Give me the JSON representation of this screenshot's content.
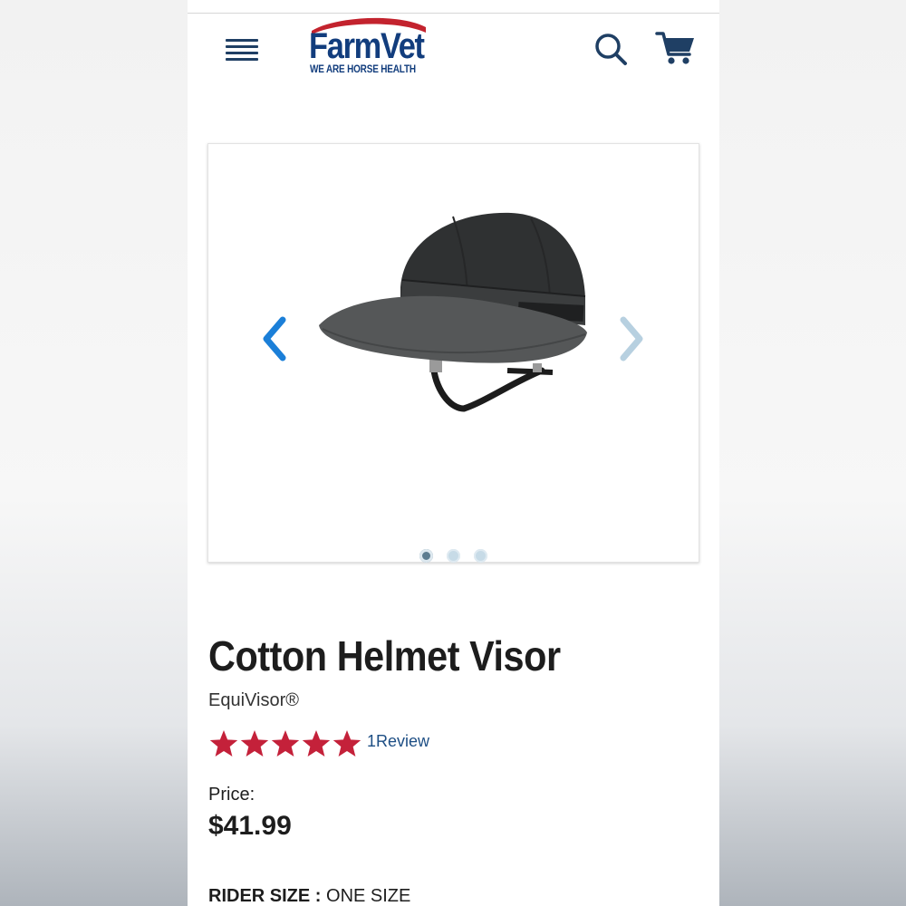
{
  "header": {
    "logo_name": "FarmVet",
    "logo_tagline": "WE ARE HORSE HEALTH",
    "icons": [
      "menu-icon",
      "search-icon",
      "cart-icon"
    ]
  },
  "gallery": {
    "image_count": 3,
    "active_index": 0,
    "icons": [
      "chevron-left-icon",
      "chevron-right-icon"
    ]
  },
  "product": {
    "title": "Cotton Helmet Visor",
    "brand": "EquiVisor®",
    "rating": 5,
    "rating_max": 5,
    "review_text": "1Review",
    "price_label": "Price:",
    "price": "$41.99",
    "size_label": "RIDER SIZE :",
    "size_value": "ONE SIZE"
  },
  "colors": {
    "brand_navy": "#123d7d",
    "logo_red": "#c3232e",
    "star_red": "#c4213a",
    "arrow_active": "#1b7fd8",
    "arrow_inactive": "#b7d0e0",
    "dot_active": "#5d7d91",
    "dot_inactive": "#c7dbe7"
  }
}
